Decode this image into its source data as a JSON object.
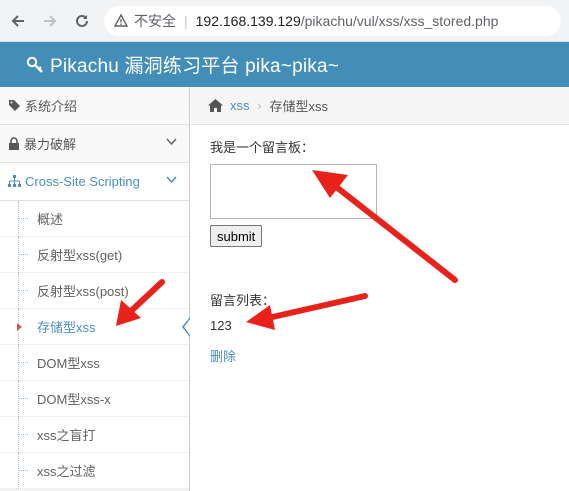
{
  "browser": {
    "insecure_label": "不安全",
    "url_host": "192.168.139.129",
    "url_path": "/pikachu/vul/xss/xss_stored.php"
  },
  "header": {
    "title": "Pikachu 漏洞练习平台 pika~pika~"
  },
  "sidebar": {
    "items": [
      {
        "label": "系统介绍",
        "icon": "tag-icon"
      },
      {
        "label": "暴力破解",
        "icon": "lock-icon"
      },
      {
        "label": "Cross-Site Scripting",
        "icon": "sitemap-icon"
      }
    ],
    "subitems": [
      {
        "label": "概述"
      },
      {
        "label": "反射型xss(get)"
      },
      {
        "label": "反射型xss(post)"
      },
      {
        "label": "存储型xss"
      },
      {
        "label": "DOM型xss"
      },
      {
        "label": "DOM型xss-x"
      },
      {
        "label": "xss之盲打"
      },
      {
        "label": "xss之过滤"
      }
    ]
  },
  "breadcrumb": {
    "link": "xss",
    "current": "存储型xss"
  },
  "main": {
    "board_label": "我是一个留言板：",
    "textarea_value": "",
    "submit_label": "submit",
    "list_label": "留言列表：",
    "messages": [
      {
        "content": "123",
        "delete_label": "删除"
      }
    ]
  },
  "colors": {
    "header_bg": "#438eb9",
    "accent": "#4c8fbd",
    "annotation_arrow": "#e8221b"
  }
}
